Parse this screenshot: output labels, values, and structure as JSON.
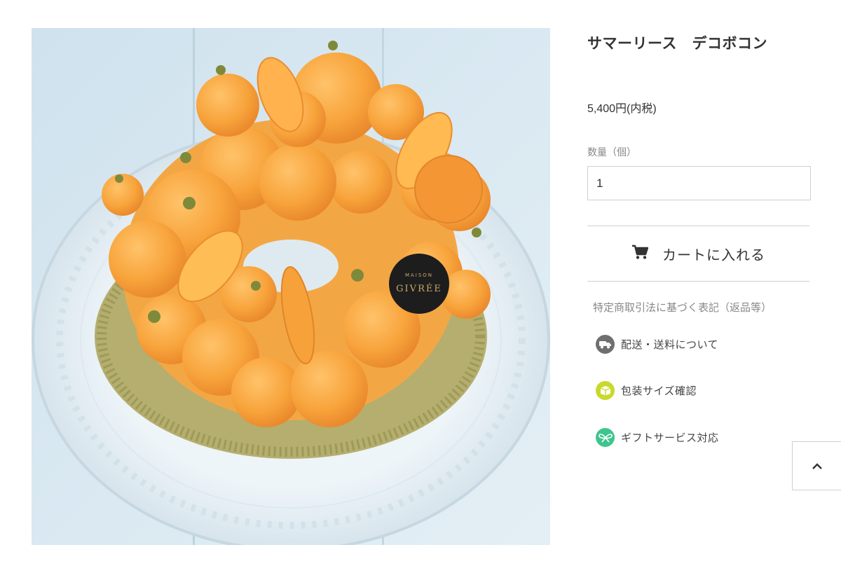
{
  "product": {
    "title": "サマーリース　デコボコン",
    "price": "5,400円(内税)",
    "quantity_label": "数量（個）",
    "quantity_value": "1",
    "cart_button": "カートに入れる",
    "cake_logo_text": "GIVRÉE",
    "cake_logo_subtext": "MAISON"
  },
  "links": {
    "legal": "特定商取引法に基づく表記（返品等）",
    "shipping": "配送・送料について",
    "package_size": "包装サイズ確認",
    "gift_service": "ギフトサービス対応"
  },
  "colors": {
    "shipping_icon_bg": "#6f6f6f",
    "package_icon_bg": "#c9d92c",
    "gift_icon_bg": "#3ec58d",
    "accent_text": "#333333"
  }
}
